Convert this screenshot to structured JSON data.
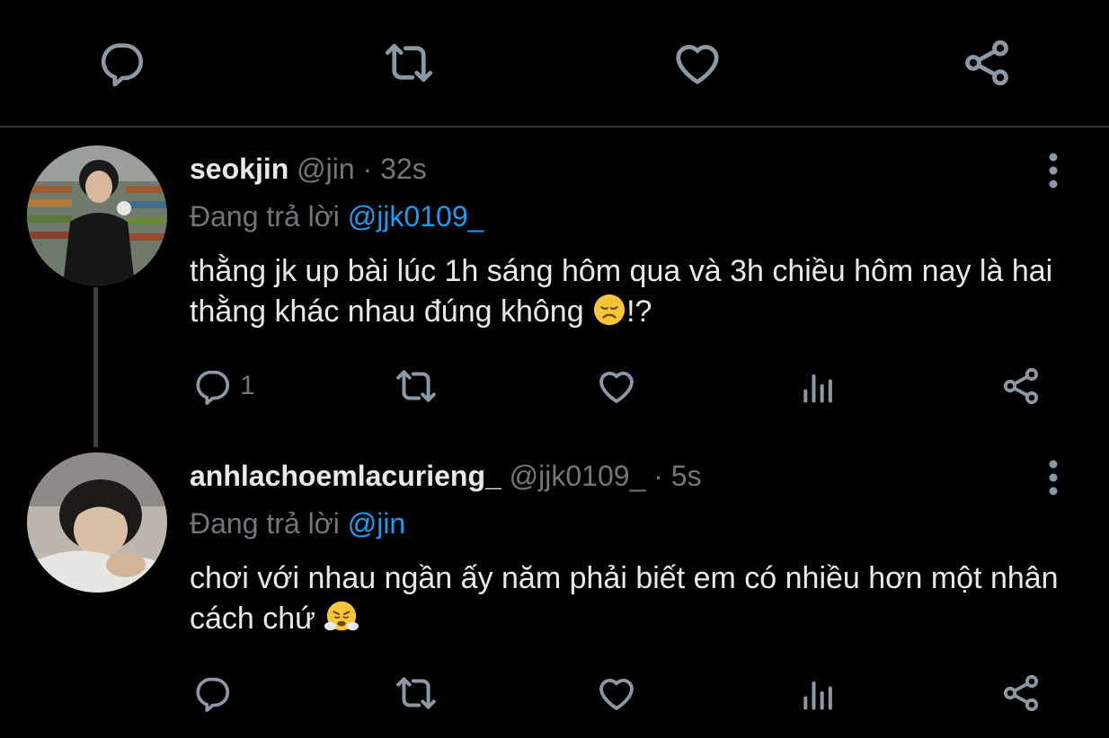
{
  "tweets": [
    {
      "name": "seokjin",
      "handle": "@jin",
      "time": "· 32s",
      "replying_prefix": "Đang trả lời",
      "replying_to": "@jjk0109_",
      "text": "thằng jk up bài lúc 1h sáng hôm qua và 3h chiều hôm nay là hai thằng khác nhau đúng không",
      "text_suffix": "!?",
      "emoji": "disappointed-face",
      "reply_count": "1"
    },
    {
      "name": "anhlachoemlacurieng_",
      "handle": "@jjk0109_",
      "time": "· 5s",
      "replying_prefix": "Đang trả lời",
      "replying_to": "@jin",
      "text": "chơi với nhau ngần ấy năm phải biết em có nhiều hơn một nhân cách chứ",
      "emoji": "face-with-steam-from-nose"
    }
  ],
  "colors": {
    "background": "#000000",
    "text": "#e7e9ea",
    "muted": "#71767b",
    "link": "#1d9bf0",
    "divider": "#2f3336"
  },
  "icons": [
    "reply-icon",
    "retweet-icon",
    "like-icon",
    "views-icon",
    "share-icon",
    "more-icon"
  ]
}
